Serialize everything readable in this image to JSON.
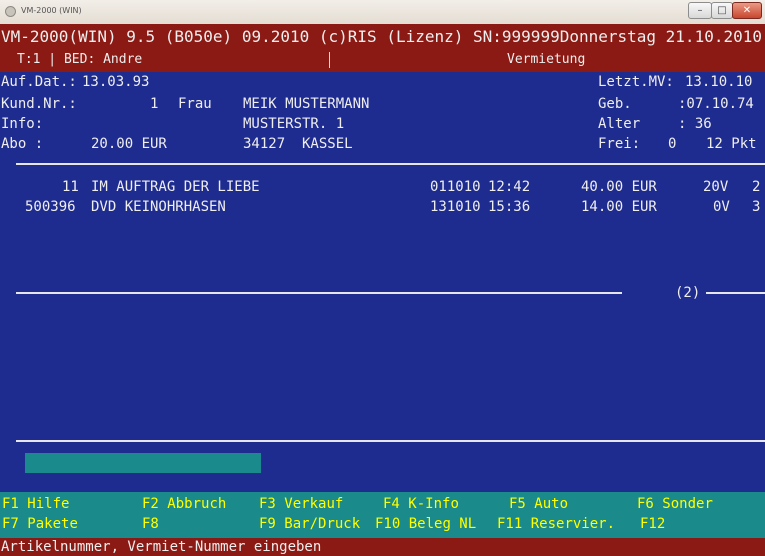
{
  "window": {
    "title": "VM-2000 (WIN)",
    "min_glyph": "–",
    "max_glyph": "□",
    "close_glyph": "✕"
  },
  "header": {
    "line1": "VM-2000(WIN) 9.5 (B050e) 09.2010 (c)RIS (Lizenz) SN:999999Donnerstag 21.10.2010",
    "terminal": "T:1 | BED: Andre",
    "mode": "Vermietung"
  },
  "customer": {
    "auf_dat_label": "Auf.Dat.:",
    "auf_dat": "13.03.93",
    "kund_nr_label": "Kund.Nr.:",
    "kund_nr": "1",
    "anrede": "Frau",
    "name": "MEIK MUSTERMANN",
    "info_label": "Info:",
    "street": "MUSTERSTR. 1",
    "abo_label": "Abo :",
    "abo": "20.00 EUR",
    "city": "34127  KASSEL",
    "letzt_mv_label": "Letzt.MV:",
    "letzt_mv": "13.10.10",
    "geb_label": "Geb.",
    "geb": ":07.10.74",
    "alter_label": "Alter",
    "alter": ": 36",
    "frei_label": "Frei:",
    "frei": "0",
    "pkt": "12 Pkt"
  },
  "rentals": [
    {
      "id": "11",
      "title": "IM AUFTRAG DER LIEBE",
      "date": "011010",
      "time": "12:42",
      "price": "40.00 EUR",
      "flag": "20V",
      "num": "2"
    },
    {
      "id": "500396",
      "title": "DVD KEINOHRHASEN",
      "date": "131010",
      "time": "15:36",
      "price": "14.00 EUR",
      "flag": "0V",
      "num": "3"
    }
  ],
  "count_label": "(2)",
  "fkeys": {
    "row1": [
      {
        "key": "F1",
        "label": "Hilfe"
      },
      {
        "key": "F2",
        "label": "Abbruch"
      },
      {
        "key": "F3",
        "label": "Verkauf"
      },
      {
        "key": "F4",
        "label": "K-Info"
      },
      {
        "key": "F5",
        "label": "Auto"
      },
      {
        "key": "F6",
        "label": "Sonder"
      }
    ],
    "row2": [
      {
        "key": "F7",
        "label": "Pakete"
      },
      {
        "key": "F8",
        "label": ""
      },
      {
        "key": "F9",
        "label": "Bar/Druck"
      },
      {
        "key": "F10",
        "label": "Beleg NL"
      },
      {
        "key": "F11",
        "label": "Reservier."
      },
      {
        "key": "F12",
        "label": ""
      }
    ]
  },
  "status_text": "Artikelnummer, Vermiet-Nummer eingeben",
  "colors": {
    "background": "#1e2b8f",
    "header": "#8c1a14",
    "fbar": "#1a8a8a",
    "highlight": "#ffff00"
  }
}
